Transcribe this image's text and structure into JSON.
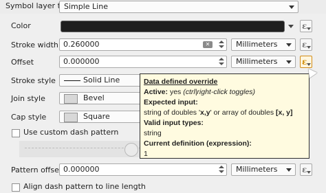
{
  "top": {
    "symbol_layer_type_label": "Symbol layer type",
    "symbol_layer_type_value": "Simple Line"
  },
  "fields": {
    "color_label": "Color",
    "stroke_width_label": "Stroke width",
    "stroke_width_value": "0.260000",
    "offset_label": "Offset",
    "offset_value": "0.000000",
    "stroke_style_label": "Stroke style",
    "stroke_style_value": "Solid Line",
    "join_style_label": "Join style",
    "join_style_value": "Bevel",
    "cap_style_label": "Cap style",
    "cap_style_value": "Square",
    "custom_dash_label": "Use custom dash pattern",
    "pattern_offset_label": "Pattern offset",
    "pattern_offset_value": "0.000000",
    "align_dash_label": "Align dash pattern to line length"
  },
  "units": {
    "stroke_width_unit": "Millimeters",
    "offset_unit": "Millimeters",
    "pattern_offset_unit": "Millimeters"
  },
  "tooltip": {
    "title": "Data defined override",
    "active_label": "Active:",
    "active_value": "yes",
    "active_hint": "(ctrl|right-click toggles)",
    "expected_label": "Expected input:",
    "expected_text_1": "string of doubles '",
    "expected_bold_1": "x,y",
    "expected_text_2": "' or array of doubles ",
    "expected_bold_2": "[x, y]",
    "valid_label": "Valid input types:",
    "valid_value": "string",
    "current_label": "Current definition (expression):",
    "current_value": "1"
  },
  "colors": {
    "background": "#efefef",
    "tooltip_background": "#fffbe0",
    "active_override": "#cf8a00",
    "color_swatch": "#1f1f1f"
  },
  "icons": {
    "data_defined": "epsilon-icon",
    "dropdown": "chevron-down-icon",
    "clear": "clear-icon",
    "stroke_style": "solid-line-icon",
    "join_style": "bevel-join-icon",
    "cap_style": "square-cap-icon"
  }
}
